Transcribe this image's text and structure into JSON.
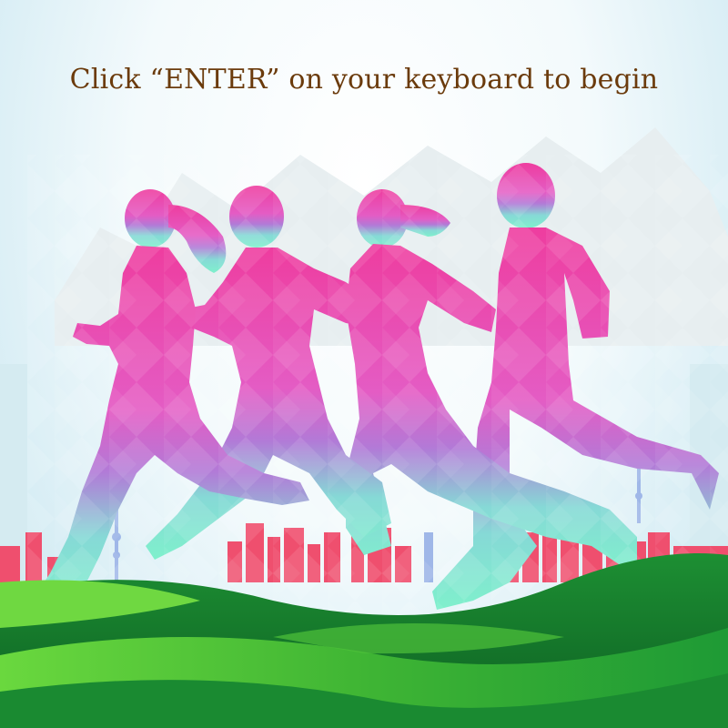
{
  "screen": {
    "prompt_text": "Click “ENTER” on your keyboard to begin"
  },
  "colors": {
    "prompt_text": "#6b3b0c",
    "runner_top": "#e8399a",
    "runner_mid": "#c15fd1",
    "runner_bottom": "#7fe6d0",
    "skyline": "#ef4f6e",
    "grass_dark": "#12782e",
    "grass_light": "#5ccf3a"
  },
  "scene": {
    "runner_count": 4,
    "elements": [
      "sky-background",
      "mountain-silhouette",
      "city-skyline",
      "runner-silhouettes",
      "grass-hills"
    ]
  }
}
